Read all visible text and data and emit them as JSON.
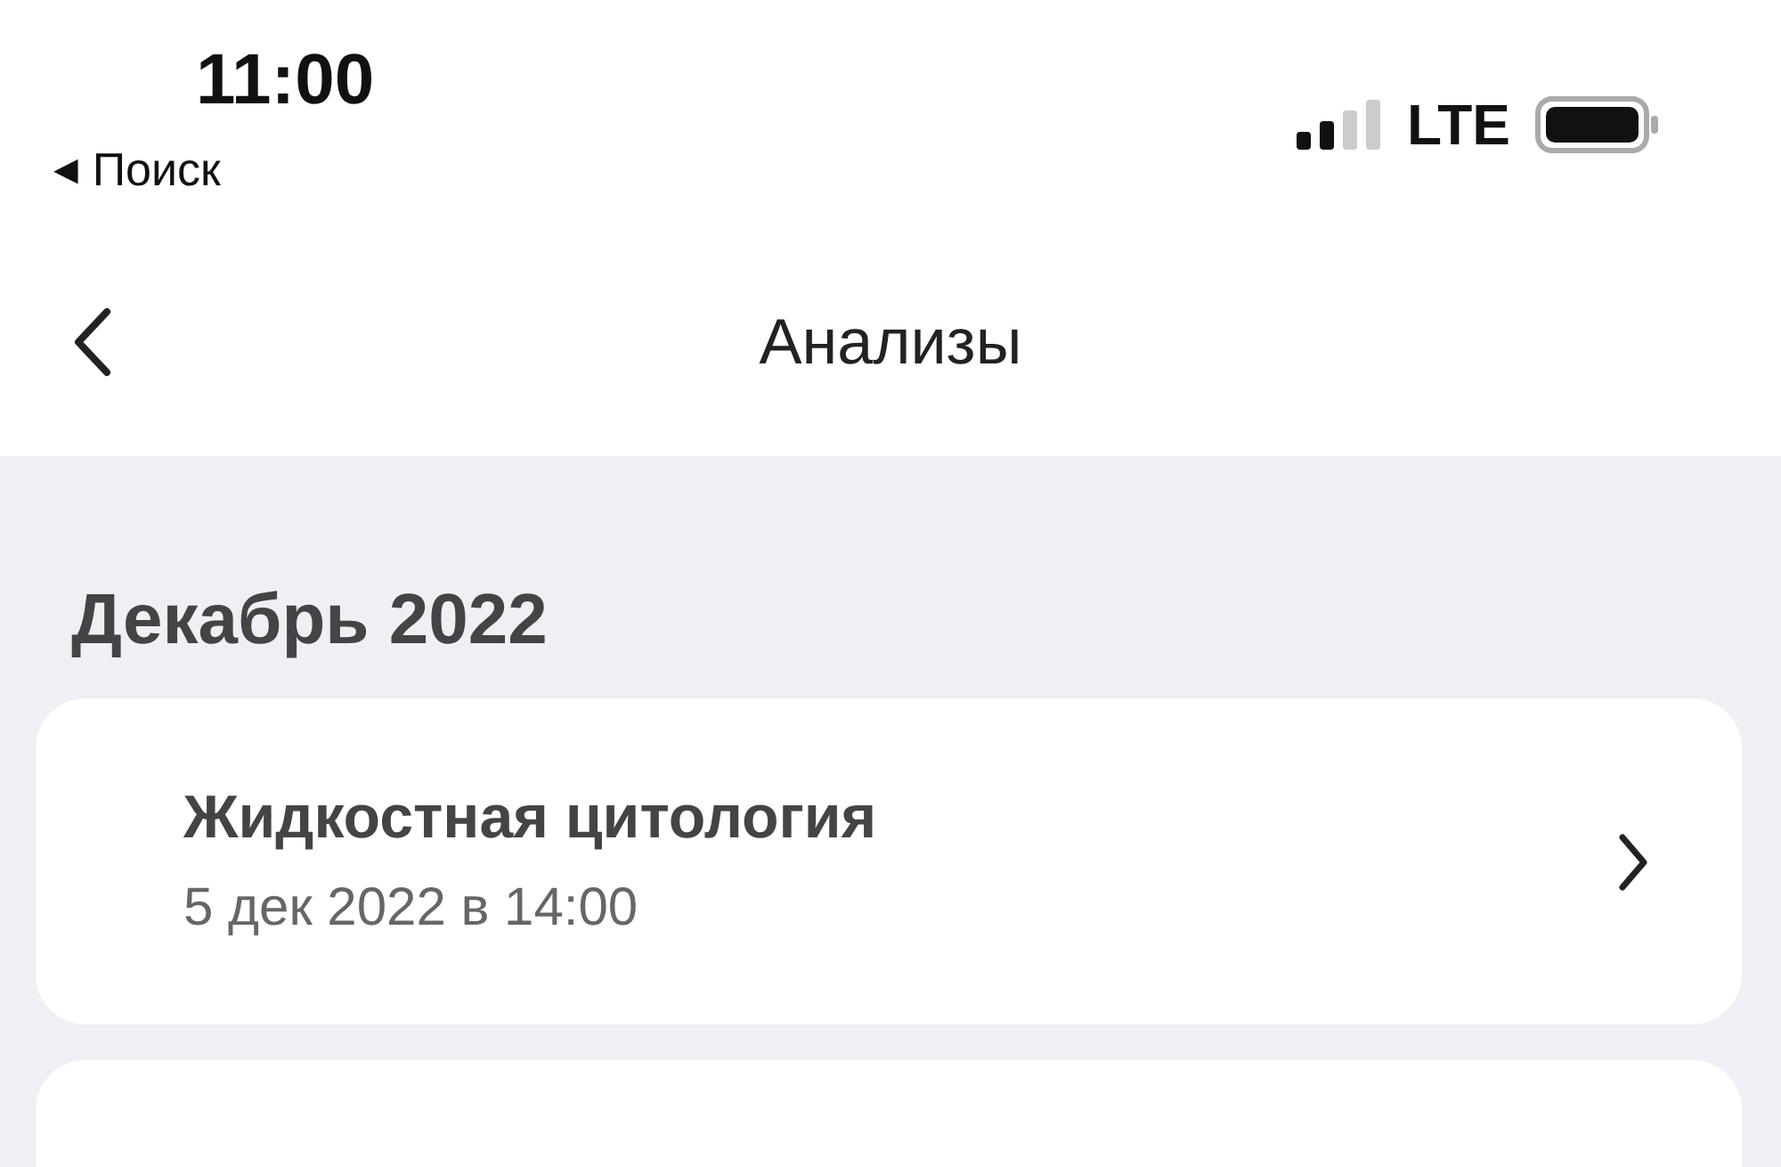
{
  "status_bar": {
    "time": "11:00",
    "back_link": {
      "arrow": "◀",
      "label": "Поиск"
    },
    "network": "LTE"
  },
  "nav": {
    "title": "Анализы"
  },
  "sections": [
    {
      "heading": "Декабрь 2022",
      "items": [
        {
          "title": "Жидкостная цитология",
          "date": "5 дек 2022 в 14:00"
        }
      ]
    }
  ]
}
